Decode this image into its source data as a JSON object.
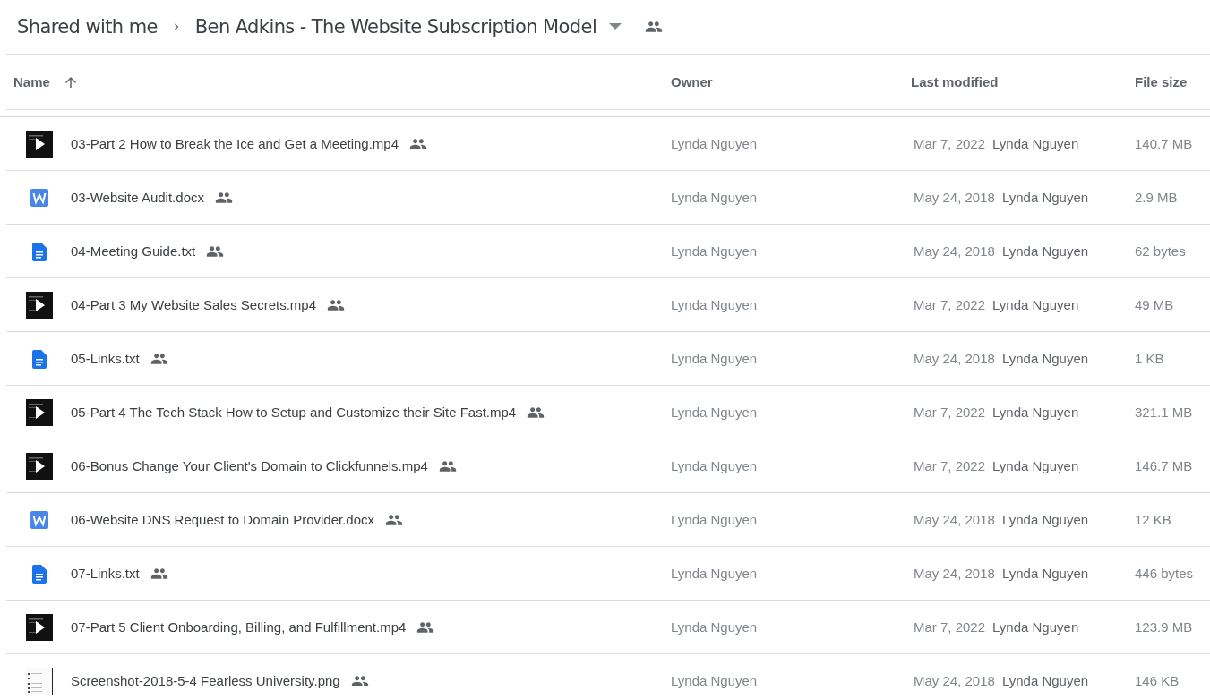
{
  "breadcrumb": {
    "parent": "Shared with me",
    "current": "Ben Adkins - The Website Subscription Model"
  },
  "table": {
    "columns": [
      {
        "label": "Name",
        "sorted": true
      },
      {
        "label": "Owner",
        "sorted": false
      },
      {
        "label": "Last modified",
        "sorted": false
      },
      {
        "label": "File size",
        "sorted": false
      }
    ],
    "rows": [
      {
        "kind": "video",
        "name": "03-Part 2 How to Break the Ice and Get a Meeting.mp4",
        "owner": "Lynda Nguyen",
        "modified_date": "Mar 7, 2022",
        "modified_by": "Lynda Nguyen",
        "size": "140.7 MB"
      },
      {
        "kind": "word",
        "name": "03-Website Audit.docx",
        "owner": "Lynda Nguyen",
        "modified_date": "May 24, 2018",
        "modified_by": "Lynda Nguyen",
        "size": "2.9 MB"
      },
      {
        "kind": "text",
        "name": "04-Meeting Guide.txt",
        "owner": "Lynda Nguyen",
        "modified_date": "May 24, 2018",
        "modified_by": "Lynda Nguyen",
        "size": "62 bytes"
      },
      {
        "kind": "video",
        "name": "04-Part 3 My Website Sales Secrets.mp4",
        "owner": "Lynda Nguyen",
        "modified_date": "Mar 7, 2022",
        "modified_by": "Lynda Nguyen",
        "size": "49 MB"
      },
      {
        "kind": "text",
        "name": "05-Links.txt",
        "owner": "Lynda Nguyen",
        "modified_date": "May 24, 2018",
        "modified_by": "Lynda Nguyen",
        "size": "1 KB"
      },
      {
        "kind": "video",
        "name": "05-Part 4 The Tech Stack How to Setup and Customize their Site Fast.mp4",
        "owner": "Lynda Nguyen",
        "modified_date": "Mar 7, 2022",
        "modified_by": "Lynda Nguyen",
        "size": "321.1 MB"
      },
      {
        "kind": "video",
        "name": "06-Bonus Change Your Client's Domain to Clickfunnels.mp4",
        "owner": "Lynda Nguyen",
        "modified_date": "Mar 7, 2022",
        "modified_by": "Lynda Nguyen",
        "size": "146.7 MB"
      },
      {
        "kind": "word",
        "name": "06-Website DNS Request to Domain Provider.docx",
        "owner": "Lynda Nguyen",
        "modified_date": "May 24, 2018",
        "modified_by": "Lynda Nguyen",
        "size": "12 KB"
      },
      {
        "kind": "text",
        "name": "07-Links.txt",
        "owner": "Lynda Nguyen",
        "modified_date": "May 24, 2018",
        "modified_by": "Lynda Nguyen",
        "size": "446 bytes"
      },
      {
        "kind": "video",
        "name": "07-Part 5 Client Onboarding, Billing, and Fulfillment.mp4",
        "owner": "Lynda Nguyen",
        "modified_date": "Mar 7, 2022",
        "modified_by": "Lynda Nguyen",
        "size": "123.9 MB"
      },
      {
        "kind": "image",
        "name": "Screenshot-2018-5-4 Fearless University.png",
        "owner": "Lynda Nguyen",
        "modified_date": "May 24, 2018",
        "modified_by": "Lynda Nguyen",
        "size": "146 KB"
      }
    ]
  }
}
